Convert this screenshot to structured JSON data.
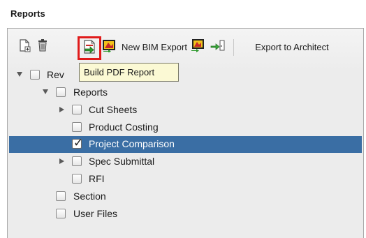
{
  "panel": {
    "title": "Reports"
  },
  "toolbar": {
    "new_bim_export_label": "New BIM Export",
    "export_to_architect_label": "Export to Architect"
  },
  "tooltip": {
    "text": "Build PDF Report"
  },
  "tree": {
    "items": [
      {
        "label": "Rev",
        "expander": "expanded",
        "checked": false
      },
      {
        "label": "Reports",
        "expander": "expanded",
        "checked": false
      },
      {
        "label": "Cut Sheets",
        "expander": "collapsed",
        "checked": false
      },
      {
        "label": "Product Costing",
        "expander": "none",
        "checked": false
      },
      {
        "label": "Project Comparison",
        "expander": "none",
        "checked": true,
        "selected": true
      },
      {
        "label": "Spec Submittal",
        "expander": "collapsed",
        "checked": false
      },
      {
        "label": "RFI",
        "expander": "none",
        "checked": false
      },
      {
        "label": "Section",
        "expander": "none",
        "checked": false
      },
      {
        "label": "User Files",
        "expander": "none",
        "checked": false
      }
    ]
  },
  "colors": {
    "selection": "#3a6ea4",
    "highlight_box": "#e01b1b",
    "tooltip_bg": "#fbf9d4",
    "icon_green": "#2e9a2e",
    "icon_yellow": "#f2c21b",
    "icon_red": "#c82a2a"
  },
  "icons": [
    "new-report-icon",
    "delete-icon",
    "build-pdf-report-icon",
    "new-bim-export-icon",
    "bim-export-icon",
    "export-to-architect-icon"
  ]
}
